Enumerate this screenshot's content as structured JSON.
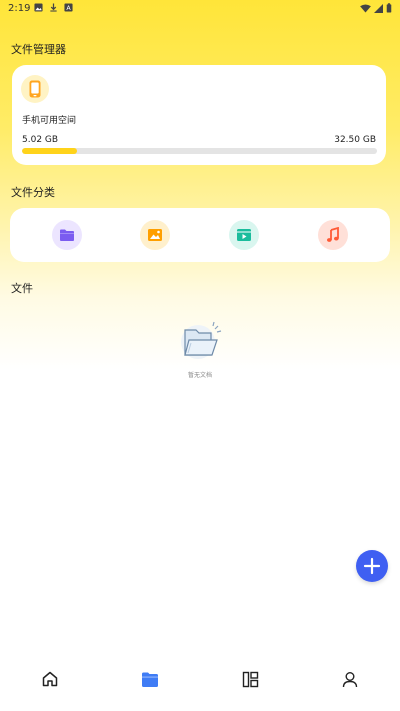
{
  "status_bar": {
    "time": "2:19",
    "left_icons": [
      "image-icon",
      "download-icon",
      "app-icon"
    ],
    "right_icons": [
      "wifi-icon",
      "signal-icon",
      "battery-icon"
    ]
  },
  "file_manager": {
    "title": "文件管理器",
    "storage": {
      "label": "手机可用空间",
      "used": "5.02 GB",
      "total": "32.50 GB",
      "used_fraction": 0.154,
      "bar_color": "#ffd31a"
    }
  },
  "categories": {
    "title": "文件分类",
    "items": [
      {
        "icon": "folder-icon",
        "color": "#7b5cf0",
        "bg": "#ece5ff"
      },
      {
        "icon": "image-icon",
        "color": "#ff9f00",
        "bg": "#fff0cc"
      },
      {
        "icon": "video-icon",
        "color": "#1abc9c",
        "bg": "#d9f6ef"
      },
      {
        "icon": "music-icon",
        "color": "#ff5a36",
        "bg": "#ffe0d8"
      }
    ]
  },
  "files": {
    "title": "文件",
    "empty_text": "暂无文档"
  },
  "fab": {
    "icon": "plus-icon",
    "color": "#3f5ff2"
  },
  "bottom_nav": {
    "items": [
      {
        "icon": "home-icon",
        "active": false
      },
      {
        "icon": "folder-icon",
        "active": true
      },
      {
        "icon": "layout-icon",
        "active": false
      },
      {
        "icon": "user-icon",
        "active": false
      }
    ],
    "active_color": "#3f7cf5"
  }
}
